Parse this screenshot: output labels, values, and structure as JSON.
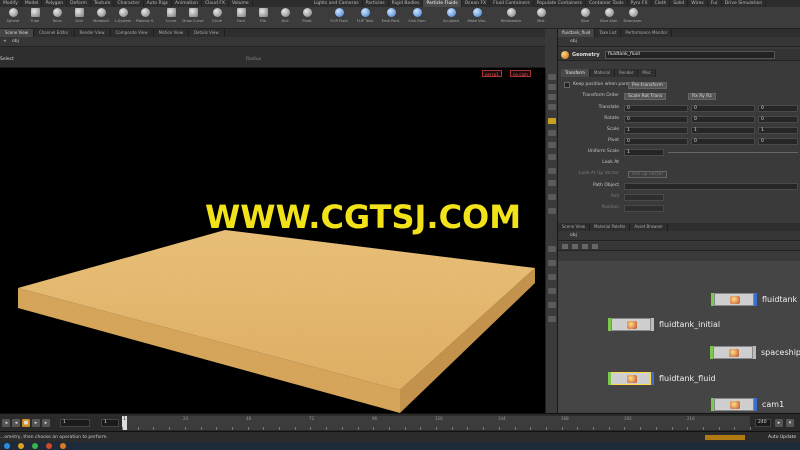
{
  "shelf": {
    "tabs_left": [
      "Modify",
      "Model",
      "Polygon",
      "Deform",
      "Texture",
      "Character",
      "Auto Rigs",
      "Animation",
      "Cloud FX",
      "Volume"
    ],
    "tabs_right": [
      "Lights and Cameras",
      "Particles",
      "Rigid Bodies",
      "Particle Fluids",
      "Ocean FX",
      "Fluid Containers",
      "Populate Containers",
      "Container Tools",
      "Pyro FX",
      "Cloth",
      "Solid",
      "Wires",
      "Fur",
      "Drive Simulation"
    ],
    "active_right_tab": "Particle Fluids",
    "tools_left": [
      "Sphere",
      "Tube",
      "Torus",
      "Grid",
      "Metaball",
      "L-System",
      "Platonic S.",
      "Curve",
      "Draw Curve",
      "Circle",
      "Font",
      "File",
      "Null",
      "Rivet"
    ],
    "tools_right": [
      "FLIP Fluid",
      "FLIP Tank",
      "Emit Parti.",
      "Sink from",
      "Sculpted",
      "Make Visc.",
      "Whitewater",
      "Mist",
      "Slice",
      "Slice Alon.",
      "Downsam."
    ]
  },
  "viewport_panel": {
    "tabs": [
      "Scene View",
      "Channel Editor",
      "Render View",
      "Composite View",
      "Motion View",
      "Details View"
    ],
    "path": "obj",
    "operation_label": "Select",
    "radius_label": "Radius",
    "persp_button": "persp1",
    "cam_button": "no cam"
  },
  "watermark": "WWW.CGTSJ.COM",
  "parameters_panel": {
    "tabs": [
      "fluidtank_fluid",
      "Take List",
      "Performance Monitor"
    ],
    "path": "obj",
    "node_type": "Geometry",
    "node_name": "fluidtank_fluid",
    "param_tabs": [
      "Transform",
      "Material",
      "Render",
      "Misc"
    ],
    "keep_position_label": "Keep position when parenting",
    "keep_position_value": "Pre-transform",
    "transform_order_label": "Transform Order",
    "transform_order_value": "Scale Rot Trans",
    "rotate_order_value": "Rx Ry Rz",
    "translate_label": "Translate",
    "translate": [
      "0",
      "0",
      "0"
    ],
    "rotate_label": "Rotate",
    "rotate": [
      "0",
      "0",
      "0"
    ],
    "scale_label": "Scale",
    "scale": [
      "1",
      "1",
      "1"
    ],
    "pivot_label": "Pivot",
    "pivot": [
      "0",
      "0",
      "0"
    ],
    "uniform_scale_label": "Uniform Scale",
    "uniform_scale": "1",
    "look_at_label": "Look At",
    "look_at_up_label": "Look At Up Vector",
    "look_at_up_value": "Use up vector",
    "path_object_label": "Path Object",
    "roll_label": "Roll",
    "position_label": "Position"
  },
  "network_panel": {
    "tabs": [
      "Scene View",
      "Material Palette",
      "Asset Browser"
    ],
    "path": "obj",
    "nodes": [
      {
        "label": "fluidtank",
        "right_flag": "#3a6fd0"
      },
      {
        "label": "fluidtank_initial",
        "right_flag": "#bbbbbb"
      },
      {
        "label": "spaceship",
        "right_flag": "#bbbbbb"
      },
      {
        "label": "fluidtank_fluid",
        "right_flag": "#3a6fd0"
      },
      {
        "label": "cam1",
        "right_flag": "#3a6fd0"
      }
    ]
  },
  "timeline": {
    "current_frame": "1",
    "start_frame": "1",
    "end_frame": "240",
    "ticks": [
      "24",
      "48",
      "72",
      "96",
      "120",
      "144",
      "168",
      "192",
      "216"
    ],
    "playhead_label": "1"
  },
  "status_bar": {
    "message": "...ometry, then choose an operation to perform.",
    "auto_update": "Auto Update"
  },
  "colors": {
    "accent": "#d08a20",
    "fluid": "#e3b46c",
    "watermark": "#f2e21a"
  }
}
